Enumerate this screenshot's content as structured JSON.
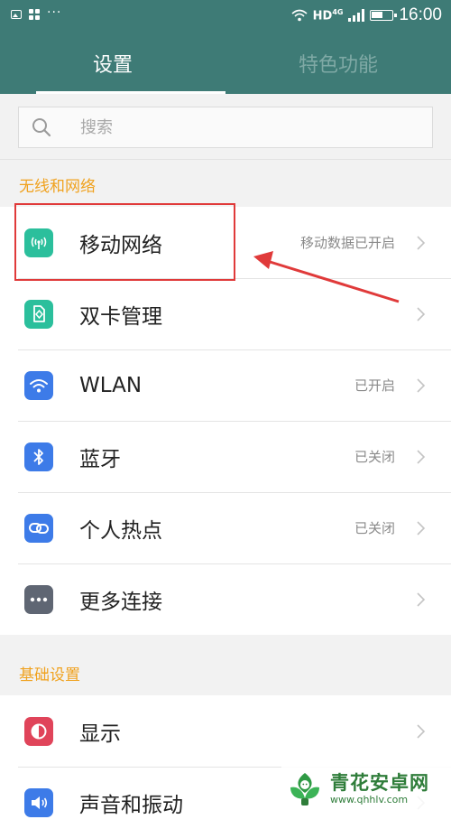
{
  "status_bar": {
    "network": "HD",
    "network_gen": "4G",
    "more": "···",
    "time": "16:00"
  },
  "tabs": [
    {
      "label": "设置",
      "active": true
    },
    {
      "label": "特色功能",
      "active": false
    }
  ],
  "search": {
    "placeholder": "搜索",
    "value": ""
  },
  "sections": [
    {
      "title": "无线和网络",
      "items": [
        {
          "label": "移动网络",
          "status": "移动数据已开启",
          "icon": "signal-tower-icon",
          "icon_color": "#2bbf9c"
        },
        {
          "label": "双卡管理",
          "status": "",
          "icon": "sim-card-icon",
          "icon_color": "#2bbf9c"
        },
        {
          "label": "WLAN",
          "status": "已开启",
          "icon": "wifi-icon",
          "icon_color": "#3d7be8"
        },
        {
          "label": "蓝牙",
          "status": "已关闭",
          "icon": "bluetooth-icon",
          "icon_color": "#3d7be8"
        },
        {
          "label": "个人热点",
          "status": "已关闭",
          "icon": "hotspot-link-icon",
          "icon_color": "#3d7be8"
        },
        {
          "label": "更多连接",
          "status": "",
          "icon": "more-dots-icon",
          "icon_color": "#5f6673"
        }
      ]
    },
    {
      "title": "基础设置",
      "items": [
        {
          "label": "显示",
          "status": "",
          "icon": "display-icon",
          "icon_color": "#e0445a"
        },
        {
          "label": "声音和振动",
          "status": "",
          "icon": "sound-icon",
          "icon_color": "#3d7be8"
        }
      ]
    }
  ],
  "watermark": {
    "name": "青花安卓网",
    "url": "www.qhhlv.com"
  },
  "colors": {
    "header": "#3e7b76",
    "section_title": "#f0a21f",
    "annotation": "#e03a3a"
  }
}
